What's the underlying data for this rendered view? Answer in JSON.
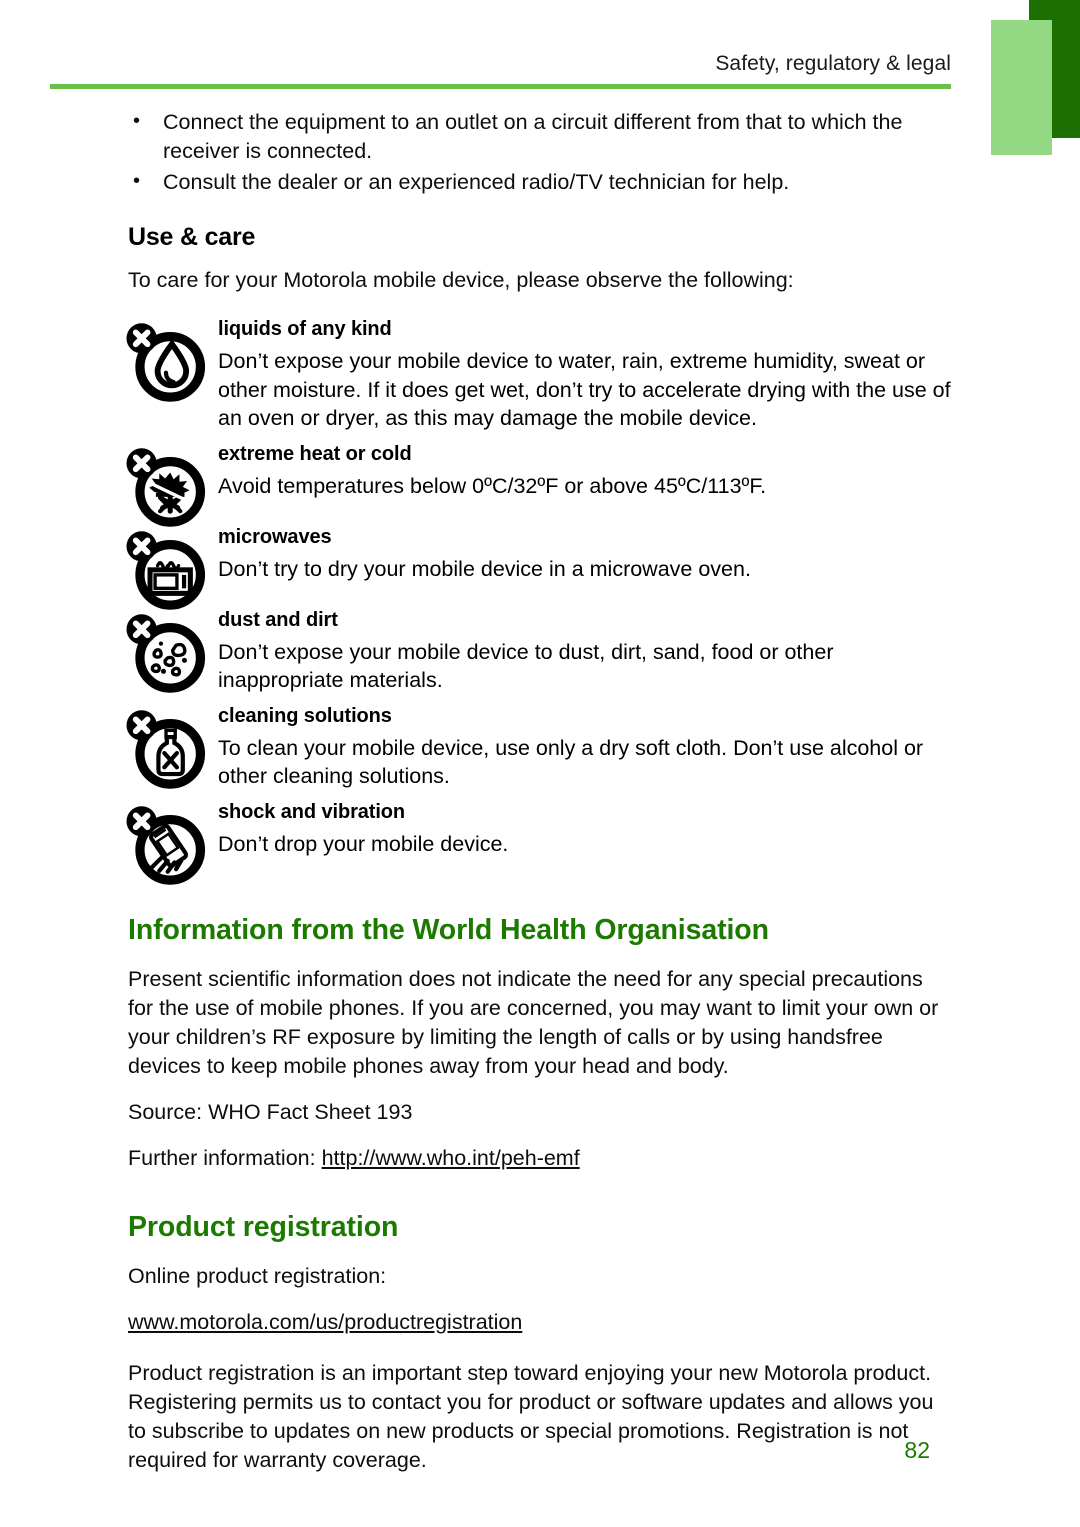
{
  "header": {
    "running_title": "Safety, regulatory & legal"
  },
  "colors": {
    "heading_green": "#1d7a00",
    "rule_green": "#6abf4b",
    "block_dark_green": "#1d7000",
    "block_light_green": "#93d882",
    "body_text": "#0d0d0d"
  },
  "bullets": [
    "Connect the equipment to an outlet on a circuit different from that to which the receiver is connected.",
    "Consult the dealer or an experienced radio/TV technician for help."
  ],
  "use_and_care": {
    "heading": "Use & care",
    "intro": "To care for your Motorola mobile device, please observe the following:",
    "items": [
      {
        "icon": "no-liquids-icon",
        "title": "liquids of any kind",
        "body": "Don’t expose your mobile device to water, rain, extreme humidity, sweat or other moisture. If it does get wet, don’t try to accelerate drying with the use of an oven or dryer, as this may damage the mobile device."
      },
      {
        "icon": "no-extreme-temperature-icon",
        "title": "extreme heat or cold",
        "body": "Avoid temperatures below 0ºC/32ºF or above 45ºC/113ºF."
      },
      {
        "icon": "no-microwave-icon",
        "title": "microwaves",
        "body": "Don’t try to dry your mobile device in a microwave oven."
      },
      {
        "icon": "no-dust-icon",
        "title": "dust and dirt",
        "body": "Don’t expose your mobile device to dust, dirt, sand, food or other inappropriate materials."
      },
      {
        "icon": "no-cleaning-solutions-icon",
        "title": "cleaning solutions",
        "body": "To clean your mobile device, use only a dry soft cloth. Don’t use alcohol or other cleaning solutions."
      },
      {
        "icon": "no-shock-icon",
        "title": "shock and vibration",
        "body": "Don’t drop your mobile device."
      }
    ]
  },
  "who_section": {
    "heading": "Information from the World Health Organisation",
    "paragraph": "Present scientific information does not indicate the need for any special precautions for the use of mobile phones. If you are concerned, you may want to limit your own or your children’s RF exposure by limiting the length of calls or by using handsfree devices to keep mobile phones away from your head and body.",
    "source": "Source: WHO Fact Sheet 193",
    "further_label": "Further information: ",
    "further_url": "http://www.who.int/peh-emf"
  },
  "registration_section": {
    "heading": "Product registration",
    "online_label": "Online product registration:",
    "url": "www.motorola.com/us/productregistration",
    "paragraph": "Product registration is an important step toward enjoying your new Motorola product. Registering permits us to contact you for product or software updates and allows you to subscribe to updates on new products or special promotions. Registration is not required for warranty coverage."
  },
  "footer": {
    "page_number": "82"
  }
}
